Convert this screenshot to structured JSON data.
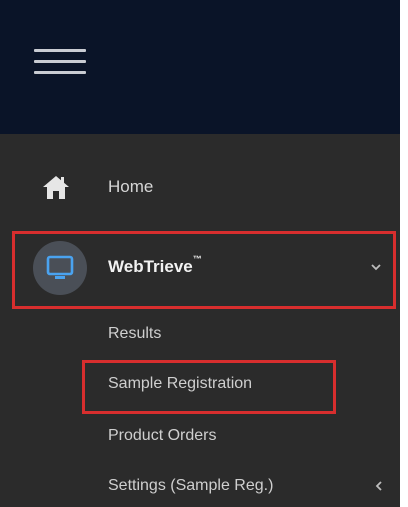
{
  "nav": {
    "menu_icon": "hamburger-menu-icon",
    "home": {
      "label": "Home",
      "icon": "home-icon"
    },
    "webtrieve": {
      "label": "WebTrieve",
      "trademark": "™",
      "icon": "monitor-icon",
      "expanded": true,
      "chevron": "chevron-down-icon",
      "items": [
        {
          "label": "Results"
        },
        {
          "label": "Sample Registration"
        },
        {
          "label": "Product Orders"
        },
        {
          "label": "Settings (Sample Reg.)",
          "chevron": "chevron-left-icon"
        }
      ]
    }
  },
  "colors": {
    "topbar": "#0a1428",
    "sidebar": "#2b2b2b",
    "highlight_border": "#d72e2e",
    "monitor_icon": "#4aa3f0"
  }
}
